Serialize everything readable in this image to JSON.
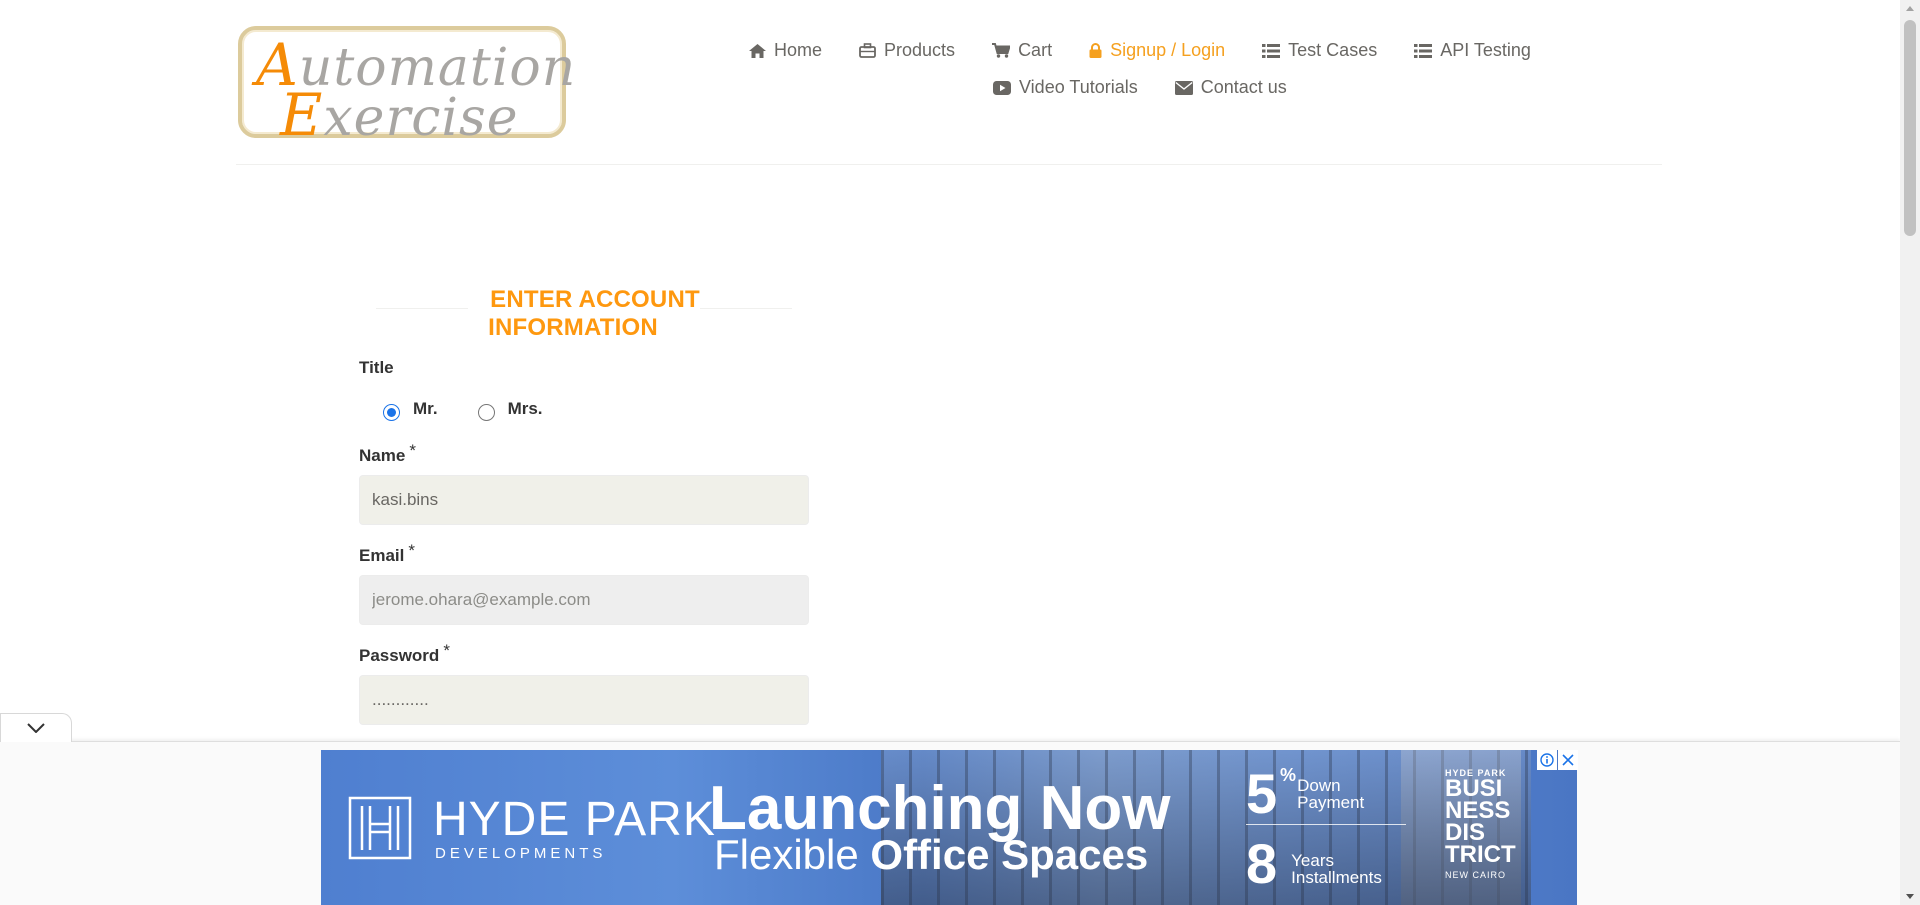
{
  "logo": {
    "line1_cap": "A",
    "line1_rest": "utomation",
    "line2_cap": "E",
    "line2_rest": "xercise"
  },
  "nav": {
    "row1": [
      {
        "label": "Home",
        "icon": "home-icon",
        "active": false
      },
      {
        "label": "Products",
        "icon": "briefcase-icon",
        "active": false
      },
      {
        "label": "Cart",
        "icon": "cart-icon",
        "active": false
      },
      {
        "label": "Signup / Login",
        "icon": "lock-icon",
        "active": true
      },
      {
        "label": "Test Cases",
        "icon": "list-icon",
        "active": false
      },
      {
        "label": "API Testing",
        "icon": "list-icon",
        "active": false
      }
    ],
    "row2": [
      {
        "label": "Video Tutorials",
        "icon": "youtube-play-icon",
        "active": false
      },
      {
        "label": "Contact us",
        "icon": "envelope-icon",
        "active": false
      }
    ]
  },
  "form": {
    "heading": "ENTER ACCOUNT INFORMATION",
    "title_label": "Title",
    "title_options": [
      {
        "label": "Mr.",
        "checked": true
      },
      {
        "label": "Mrs.",
        "checked": false
      }
    ],
    "name_label": "Name",
    "name_value": "kasi.bins",
    "email_label": "Email",
    "email_value": "jerome.ohara@example.com",
    "password_label": "Password",
    "password_value": "............",
    "required_mark": "*"
  },
  "ad": {
    "brand": "HYDE PARK",
    "brand_sub": "DEVELOPMENTS",
    "headline": "Launching Now",
    "subline_light": "Flexible",
    "subline_bold": "Office Spaces",
    "stat1_big": "5",
    "stat1_pct": "%",
    "stat1_line1": "Down",
    "stat1_line2": "Payment",
    "stat2_big": "8",
    "stat2_line1": "Years",
    "stat2_line2": "Installments",
    "district_top": "HYDE PARK",
    "district_w1": "BUSI",
    "district_w2": "NESS",
    "district_w3": "DIS",
    "district_w4": "TRICT",
    "district_bottom": "NEW CAIRO"
  },
  "colors": {
    "accent_orange": "#FE980F",
    "nav_text": "#696763",
    "ad_blue": "#4F7FD0"
  }
}
